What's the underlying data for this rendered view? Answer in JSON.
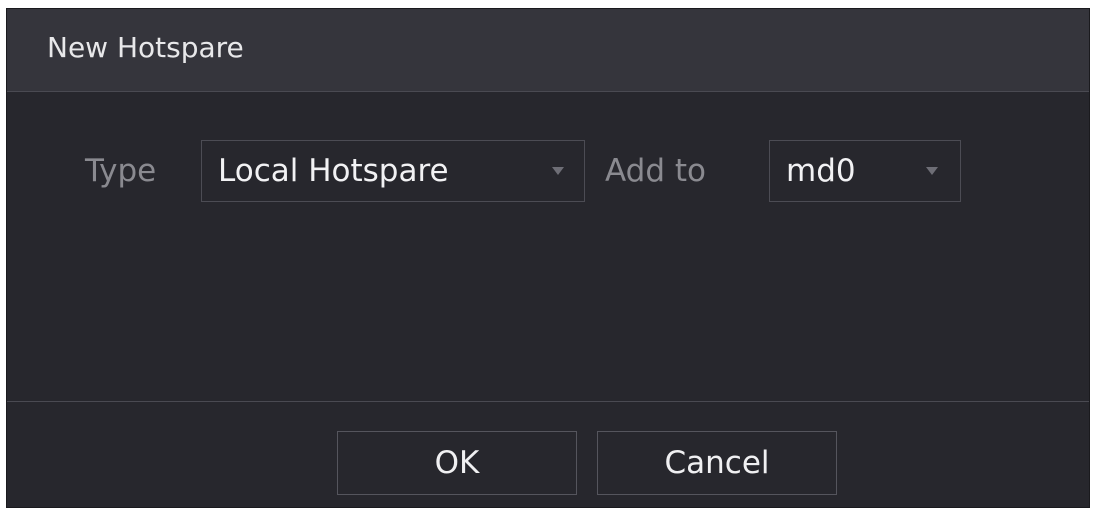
{
  "dialog": {
    "title": "New Hotspare"
  },
  "form": {
    "type_label": "Type",
    "type_value": "Local Hotspare",
    "add_to_label": "Add to",
    "add_to_value": "md0"
  },
  "buttons": {
    "ok_label": "OK",
    "cancel_label": "Cancel"
  },
  "icons": {
    "dropdown": "chevron-down-icon"
  },
  "colors": {
    "title_bar": "#35353c",
    "body": "#27272d",
    "border": "#4c4c54",
    "label_text": "#8a8a90",
    "value_text": "#f2f2f4"
  }
}
